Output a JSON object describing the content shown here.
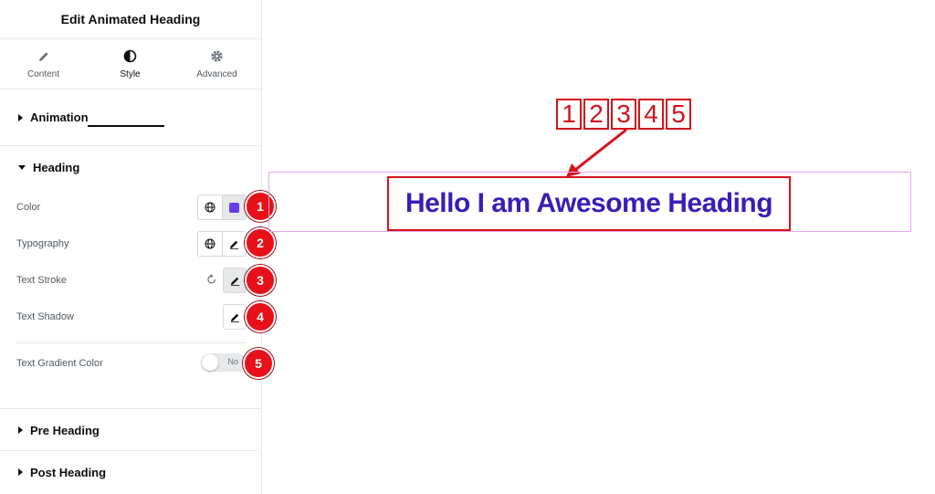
{
  "panel": {
    "title": "Edit Animated Heading",
    "tabs": [
      {
        "label": "Content",
        "icon": "pencil-icon"
      },
      {
        "label": "Style",
        "icon": "half-circle-icon"
      },
      {
        "label": "Advanced",
        "icon": "gear-icon"
      }
    ],
    "active_tab": "Style",
    "sections": {
      "animation": "Animation",
      "heading": "Heading",
      "pre_heading": "Pre Heading",
      "post_heading": "Post Heading"
    },
    "controls": {
      "color": "Color",
      "typography": "Typography",
      "text_stroke": "Text Stroke",
      "text_shadow": "Text Shadow",
      "text_gradient": "Text Gradient Color",
      "toggle_state": "No"
    },
    "color_swatch": "#6a3cf0"
  },
  "badges": [
    "1",
    "2",
    "3",
    "4",
    "5"
  ],
  "annotation": {
    "digits": [
      "1",
      "2",
      "3",
      "4",
      "5"
    ]
  },
  "canvas": {
    "heading": "Hello I am Awesome Heading"
  },
  "colors": {
    "accent_red": "#e8111a",
    "heading_color": "#3b1cb5",
    "frame_pink": "#e6a6f0"
  }
}
